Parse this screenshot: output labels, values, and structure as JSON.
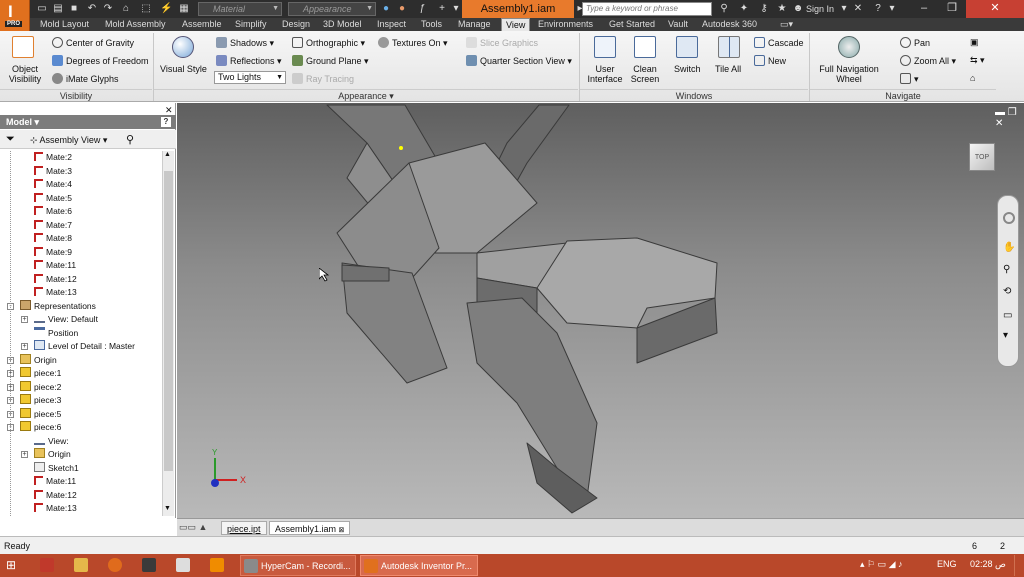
{
  "titlebar": {
    "material_placeholder": "Material",
    "appearance_placeholder": "Appearance",
    "document_title": "Assembly1.iam",
    "search_placeholder": "Type a keyword or phrase",
    "sign_in": "Sign In",
    "app_badge": "PRO"
  },
  "tabs": [
    "Mold Layout",
    "Mold Assembly",
    "Assemble",
    "Simplify",
    "Design",
    "3D Model",
    "Inspect",
    "Tools",
    "Manage",
    "View",
    "Environments",
    "Get Started",
    "Vault",
    "Autodesk 360"
  ],
  "active_tab": "View",
  "ribbon": {
    "visibility": {
      "title": "Visibility",
      "object_visibility": "Object Visibility",
      "center_of_gravity": "Center of Gravity",
      "degrees_of_freedom": "Degrees of Freedom",
      "imate_glyphs": "iMate Glyphs"
    },
    "appearance": {
      "title": "Appearance",
      "visual_style": "Visual Style",
      "shadows": "Shadows",
      "reflections": "Reflections",
      "lighting": "Two Lights",
      "orthographic": "Orthographic",
      "ground_plane": "Ground Plane",
      "ray_tracing": "Ray Tracing",
      "textures_on": "Textures On",
      "slice_graphics": "Slice Graphics",
      "quarter_section": "Quarter Section View"
    },
    "windows": {
      "title": "Windows",
      "user_interface": "User Interface",
      "clean_screen": "Clean Screen",
      "switch": "Switch",
      "tile_all": "Tile All",
      "cascade": "Cascade",
      "new": "New"
    },
    "navigate": {
      "title": "Navigate",
      "full_nav_wheel": "Full Navigation Wheel",
      "pan": "Pan",
      "zoom_all": "Zoom All"
    }
  },
  "browser": {
    "title": "Model",
    "view_mode": "Assembly View",
    "tree": [
      {
        "label": "Mate:2",
        "icon": "mate",
        "indent": 2
      },
      {
        "label": "Mate:3",
        "icon": "mate",
        "indent": 2
      },
      {
        "label": "Mate:4",
        "icon": "mate",
        "indent": 2
      },
      {
        "label": "Mate:5",
        "icon": "mate",
        "indent": 2
      },
      {
        "label": "Mate:6",
        "icon": "mate",
        "indent": 2
      },
      {
        "label": "Mate:7",
        "icon": "mate",
        "indent": 2
      },
      {
        "label": "Mate:8",
        "icon": "mate",
        "indent": 2
      },
      {
        "label": "Mate:9",
        "icon": "mate",
        "indent": 2
      },
      {
        "label": "Mate:11",
        "icon": "mate",
        "indent": 2
      },
      {
        "label": "Mate:12",
        "icon": "mate",
        "indent": 2
      },
      {
        "label": "Mate:13",
        "icon": "mate",
        "indent": 2
      },
      {
        "label": "Representations",
        "icon": "rep",
        "indent": 1,
        "exp": "-"
      },
      {
        "label": "View: Default",
        "icon": "view",
        "indent": 2,
        "exp": "+"
      },
      {
        "label": "Position",
        "icon": "pos",
        "indent": 2
      },
      {
        "label": "Level of Detail : Master",
        "icon": "lod",
        "indent": 2,
        "exp": "+"
      },
      {
        "label": "Origin",
        "icon": "folder",
        "indent": 1,
        "exp": "+"
      },
      {
        "label": "piece:1",
        "icon": "cube",
        "indent": 1,
        "exp": "+"
      },
      {
        "label": "piece:2",
        "icon": "cube",
        "indent": 1,
        "exp": "+"
      },
      {
        "label": "piece:3",
        "icon": "cube",
        "indent": 1,
        "exp": "+"
      },
      {
        "label": "piece:5",
        "icon": "cube",
        "indent": 1,
        "exp": "+"
      },
      {
        "label": "piece:6",
        "icon": "cube",
        "indent": 1,
        "exp": "-"
      },
      {
        "label": "View:",
        "icon": "view",
        "indent": 2
      },
      {
        "label": "Origin",
        "icon": "folder",
        "indent": 2,
        "exp": "+"
      },
      {
        "label": "Sketch1",
        "icon": "sketch",
        "indent": 2
      },
      {
        "label": "Mate:11",
        "icon": "mate",
        "indent": 2
      },
      {
        "label": "Mate:12",
        "icon": "mate",
        "indent": 2
      },
      {
        "label": "Mate:13",
        "icon": "mate",
        "indent": 2
      }
    ]
  },
  "viewcube_label": "TOP",
  "triad": {
    "x": "X",
    "y": "Y"
  },
  "doc_tabs": [
    "piece.ipt",
    "Assembly1.iam"
  ],
  "status": {
    "text": "Ready",
    "count1": "6",
    "count2": "2"
  },
  "taskbar": {
    "items": [
      "HyperCam - Recordi...",
      "Autodesk Inventor Pr..."
    ],
    "lang": "ENG",
    "time": "02:28 ص"
  }
}
